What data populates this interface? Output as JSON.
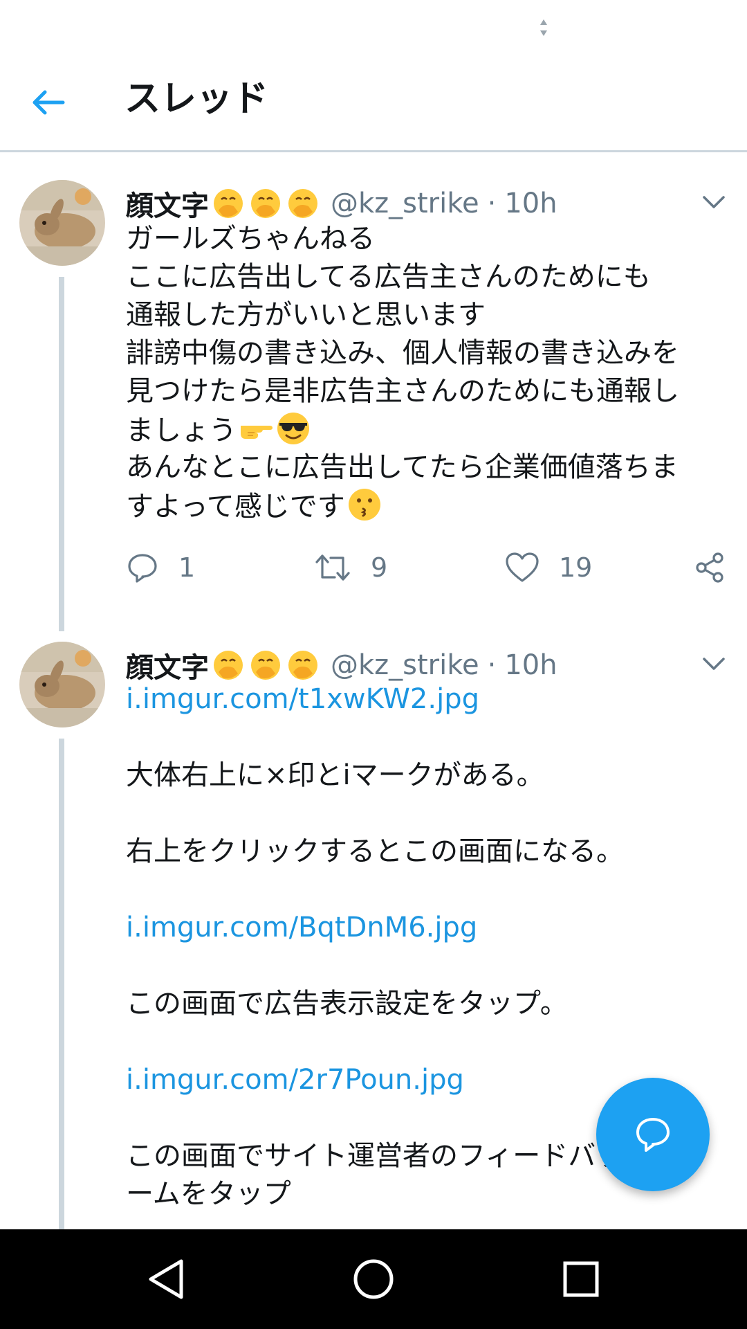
{
  "header": {
    "title": "スレッド"
  },
  "tweets": [
    {
      "name": "顔文字",
      "handle": "@kz_strike",
      "dot": "·",
      "time": "10h",
      "lines": [
        "ガールズちゃんねる",
        "ここに広告出してる広告主さんのためにも",
        "通報した方がいいと思います",
        "誹謗中傷の書き込み、個人情報の書き込みを",
        "見つけたら是非広告主さんのためにも通報し",
        "ましょう",
        "あんなとこに広告出してたら企業価値落ちま",
        "すよって感じです"
      ],
      "actions": {
        "reply_count": "1",
        "retweet_count": "9",
        "like_count": "19"
      }
    },
    {
      "name": "顔文字",
      "handle": "@kz_strike",
      "dot": "·",
      "time": "10h",
      "link1": "i.imgur.com/t1xwKW2.jpg",
      "text1": "大体右上に×印とiマークがある。",
      "text2": "右上をクリックするとこの画面になる。",
      "link2": "i.imgur.com/BqtDnM6.jpg",
      "text3": "この画面で広告表示設定をタップ。",
      "link3": "i.imgur.com/2r7Poun.jpg",
      "text4": "この画面でサイト運営者のフィードバックフォ",
      "text5": "ームをタップ"
    }
  ],
  "colors": {
    "accent": "#1da1f2",
    "link": "#1b95e0",
    "muted": "#657786",
    "divider": "#ccd6dd"
  },
  "icons": [
    "back-arrow-icon",
    "caret-down-icon",
    "reply-icon",
    "retweet-icon",
    "like-icon",
    "share-icon",
    "compose-reply-icon",
    "nav-back-icon",
    "nav-home-icon",
    "nav-recents-icon"
  ]
}
